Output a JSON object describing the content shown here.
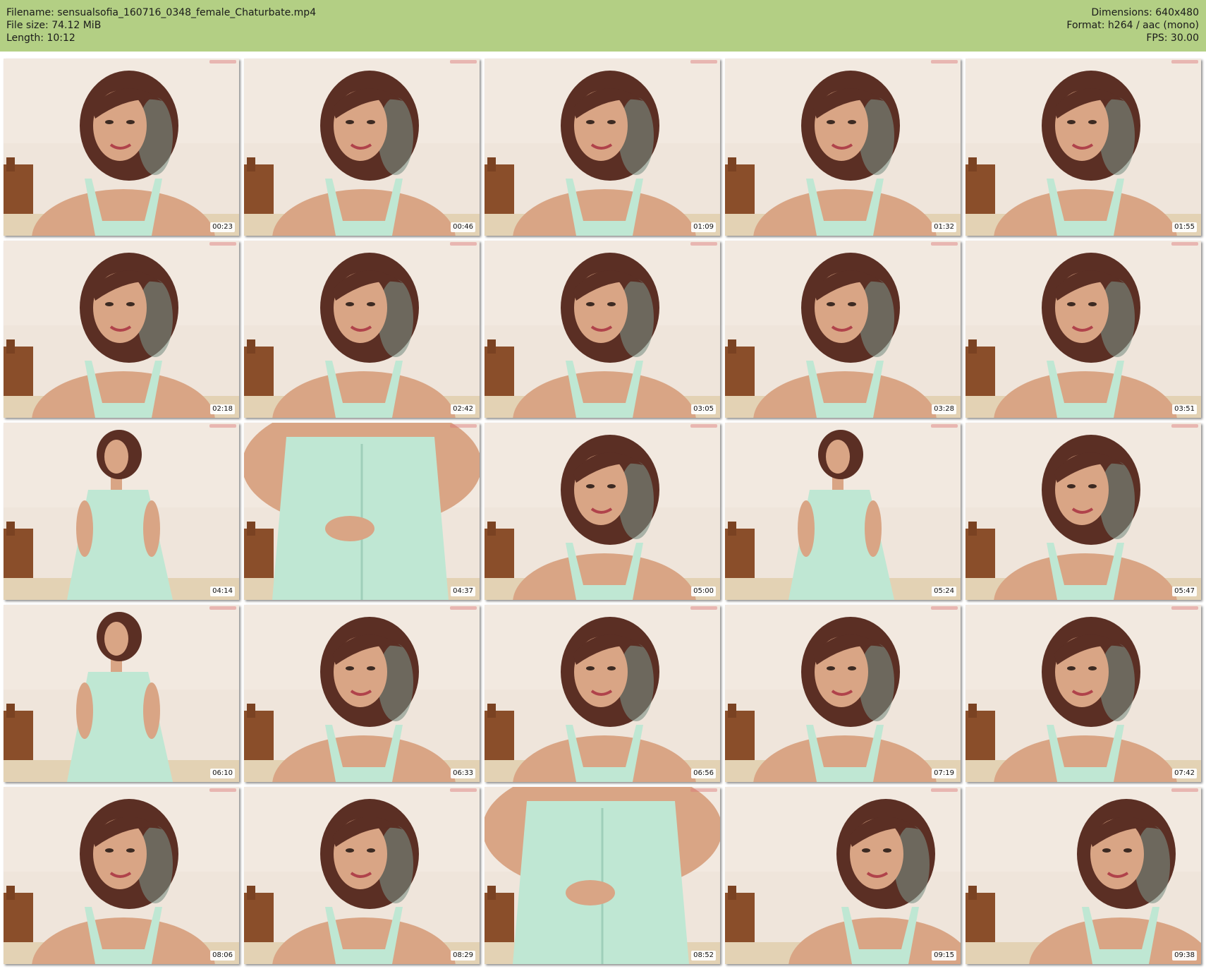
{
  "header": {
    "filename": "Filename: sensualsofia_160716_0348_female_Chaturbate.mp4",
    "filesize": "File size: 74.12 MiB",
    "length": "Length: 10:12",
    "dimensions": "Dimensions: 640x480",
    "format": "Format: h264 / aac (mono)",
    "fps": "FPS: 30.00"
  },
  "colors": {
    "header_bg": "#b3cf84",
    "page_bg": "#ffffff"
  },
  "thumbnails": [
    {
      "time": "00:23",
      "scene": "close"
    },
    {
      "time": "00:46",
      "scene": "close"
    },
    {
      "time": "01:09",
      "scene": "close"
    },
    {
      "time": "01:32",
      "scene": "close"
    },
    {
      "time": "01:55",
      "scene": "close"
    },
    {
      "time": "02:18",
      "scene": "close"
    },
    {
      "time": "02:42",
      "scene": "close"
    },
    {
      "time": "03:05",
      "scene": "close"
    },
    {
      "time": "03:28",
      "scene": "close"
    },
    {
      "time": "03:51",
      "scene": "close"
    },
    {
      "time": "04:14",
      "scene": "full"
    },
    {
      "time": "04:37",
      "scene": "torso"
    },
    {
      "time": "05:00",
      "scene": "close"
    },
    {
      "time": "05:24",
      "scene": "full"
    },
    {
      "time": "05:47",
      "scene": "close"
    },
    {
      "time": "06:10",
      "scene": "full"
    },
    {
      "time": "06:33",
      "scene": "close"
    },
    {
      "time": "06:56",
      "scene": "close"
    },
    {
      "time": "07:19",
      "scene": "close"
    },
    {
      "time": "07:42",
      "scene": "close"
    },
    {
      "time": "08:06",
      "scene": "close"
    },
    {
      "time": "08:29",
      "scene": "close"
    },
    {
      "time": "08:52",
      "scene": "torso"
    },
    {
      "time": "09:15",
      "scene": "lean"
    },
    {
      "time": "09:38",
      "scene": "lean"
    }
  ]
}
